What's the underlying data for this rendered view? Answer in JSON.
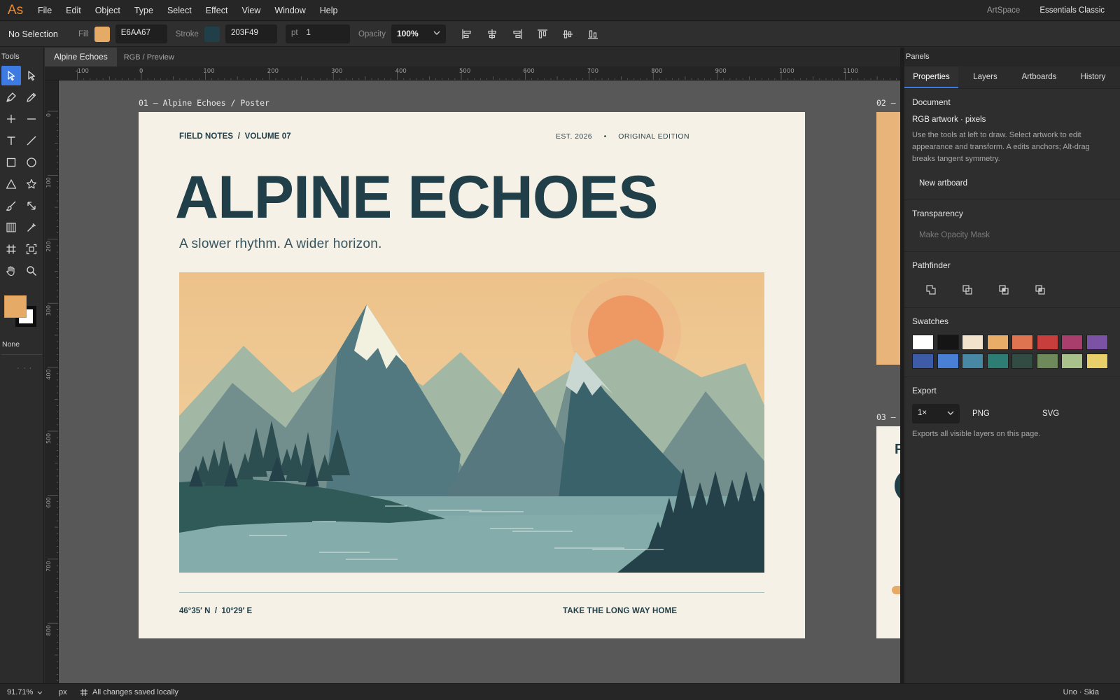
{
  "app": {
    "logo": "As"
  },
  "menu": [
    "File",
    "Edit",
    "Object",
    "Type",
    "Select",
    "Effect",
    "View",
    "Window",
    "Help"
  ],
  "workspace": {
    "name": "ArtSpace",
    "preset": "Essentials Classic"
  },
  "control_bar": {
    "selection": "No Selection",
    "fill_label": "Fill",
    "fill_hex": "E6AA67",
    "fill_color": "#E6AA67",
    "stroke_label": "Stroke",
    "stroke_hex": "203F49",
    "stroke_color": "#203F49",
    "stroke_unit": "pt",
    "stroke_weight": "1",
    "opacity_label": "Opacity",
    "opacity": "100%"
  },
  "tools": {
    "title": "Tools",
    "items": [
      "selection-tool",
      "direct-selection-tool",
      "pen-tool",
      "pencil-tool",
      "add-anchor-tool",
      "delete-anchor-tool",
      "type-tool",
      "line-tool",
      "rectangle-tool",
      "ellipse-tool",
      "polygon-tool",
      "star-tool",
      "paintbrush-tool",
      "scale-tool",
      "gradient-tool",
      "eyedropper-tool",
      "slice-tool",
      "artboard-tool",
      "hand-tool",
      "zoom-tool"
    ],
    "active": "selection-tool",
    "fill_color": "#E6AA67",
    "stroke_color": "#FFFFFF",
    "none_label": "None",
    "more": "· · ·"
  },
  "document": {
    "tab": "Alpine Echoes",
    "mode": "RGB / Preview"
  },
  "rulers": {
    "horizontal": [
      "-100",
      "0",
      "100",
      "200",
      "300",
      "400",
      "500",
      "600",
      "700",
      "800",
      "900",
      "1000",
      "1100"
    ],
    "vertical": [
      "0",
      "100",
      "200",
      "300",
      "400",
      "500",
      "600",
      "700",
      "800"
    ]
  },
  "artboards": [
    {
      "label": "01 — Alpine Echoes / Poster"
    },
    {
      "label": "02 —"
    },
    {
      "label": "03 —"
    }
  ],
  "poster": {
    "kicker": "FIELD NOTES  /  VOLUME 07",
    "est": "EST. 2026     •     ORIGINAL EDITION",
    "title": "ALPINE ECHOES",
    "subtitle": "A slower rhythm. A wider horizon.",
    "coords": "46°35′ N  /  10°29′ E",
    "tagline": "TAKE THE LONG WAY HOME",
    "colors": {
      "paper": "#F6F1E6",
      "ink": "#203F49",
      "sky": "#EDC58D",
      "sun": "#EE9863",
      "far_mountain": "#A4B9A6",
      "mid_mountain": "#527880",
      "near_mountain": "#3A626A",
      "lake": "#7FA7A7",
      "forest": "#244149",
      "snow": "#F2F1E2"
    }
  },
  "artboard3": {
    "fragment": "P"
  },
  "panels": {
    "title": "Panels",
    "tabs": [
      "Properties",
      "Layers",
      "Artboards",
      "History"
    ],
    "active_tab": "Properties",
    "document": {
      "title": "Document",
      "name": "RGB artwork · pixels",
      "help": "Use the tools at left to draw. Select artwork to edit appearance and transform. A edits anchors; Alt-drag breaks tangent symmetry.",
      "new_artboard": "New artboard"
    },
    "transparency": {
      "title": "Transparency",
      "mask_button": "Make Opacity Mask"
    },
    "pathfinder": {
      "title": "Pathfinder",
      "ops": [
        "unite-icon",
        "minus-front-icon",
        "intersect-icon",
        "exclude-icon"
      ]
    },
    "swatches": {
      "title": "Swatches",
      "colors": [
        "#FFFFFF",
        "#151515",
        "#F2E4CC",
        "#E8AE67",
        "#DE7450",
        "#C83E3C",
        "#A93D6B",
        "#7C52A4",
        "#3E5BA8",
        "#4A7FD6",
        "#4888A4",
        "#2E7D75",
        "#324C43",
        "#6E8A5A",
        "#A9C28C",
        "#E7CF6A"
      ]
    },
    "export": {
      "title": "Export",
      "scale": "1×",
      "formats": [
        "PNG",
        "SVG"
      ],
      "help": "Exports all visible layers on this page."
    }
  },
  "status": {
    "zoom": "91.71%",
    "units": "px",
    "message": "All changes saved locally",
    "renderer": "Uno · Skia"
  }
}
